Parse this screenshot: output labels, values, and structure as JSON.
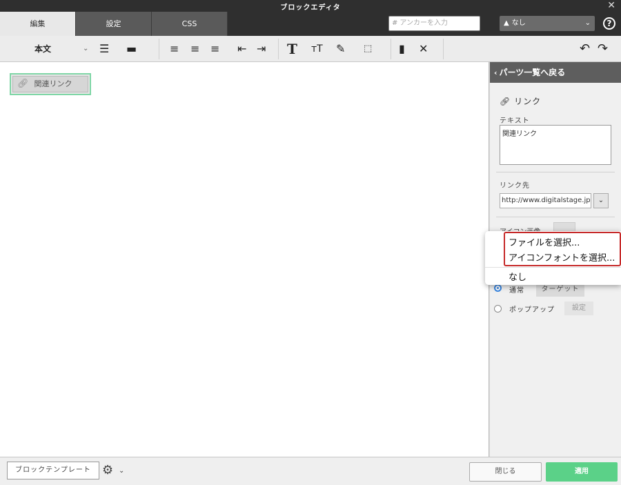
{
  "window": {
    "title": "ブロックエディタ"
  },
  "tabs": [
    {
      "label": "編集"
    },
    {
      "label": "設定"
    },
    {
      "label": "CSS"
    }
  ],
  "header": {
    "anchor_placeholder": "アンカーを入力",
    "anchor_hash": "#",
    "style_select": "なし"
  },
  "toolbar": {
    "paragraph_style": "本文"
  },
  "canvas": {
    "link_part_label": "関連リンク"
  },
  "panel": {
    "back_label": "パーツ一覧へ戻る",
    "part_title": "リンク",
    "text_label": "テキスト",
    "text_value": "関連リンク",
    "link_label": "リンク先",
    "link_value": "http://www.digitalstage.jp",
    "icon_label": "アイコン画像",
    "radio_normal": "通常",
    "target_button": "ターゲット",
    "radio_popup": "ポップアップ",
    "popup_setting_button": "設定"
  },
  "menu": {
    "items": [
      {
        "label": "ファイルを選択..."
      },
      {
        "label": "アイコンフォントを選択..."
      },
      {
        "label": "なし"
      }
    ]
  },
  "footer": {
    "template_button": "ブロックテンプレート",
    "close_button": "閉じる",
    "apply_button": "適用"
  },
  "colors": {
    "accent_green": "#5bd188",
    "highlight_red": "#c62828",
    "dark_bar": "#2f2f2f"
  }
}
